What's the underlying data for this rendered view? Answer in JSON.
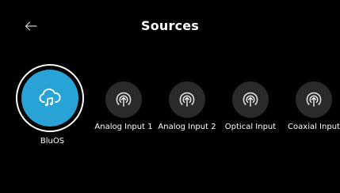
{
  "header": {
    "title": "Sources",
    "back_icon": "arrow-left-icon"
  },
  "sources": [
    {
      "label": "BluOS",
      "icon": "cloud-music-icon",
      "selected": true
    },
    {
      "label": "Analog Input 1",
      "icon": "input-arrow-icon",
      "selected": false
    },
    {
      "label": "Analog Input 2",
      "icon": "input-arrow-icon",
      "selected": false
    },
    {
      "label": "Optical Input",
      "icon": "input-arrow-icon",
      "selected": false
    },
    {
      "label": "Coaxial Input",
      "icon": "input-arrow-icon",
      "selected": false
    }
  ],
  "colors": {
    "background": "#000000",
    "accent": "#29a3d6",
    "tile": "#2a2a2a",
    "text": "#ffffff"
  }
}
